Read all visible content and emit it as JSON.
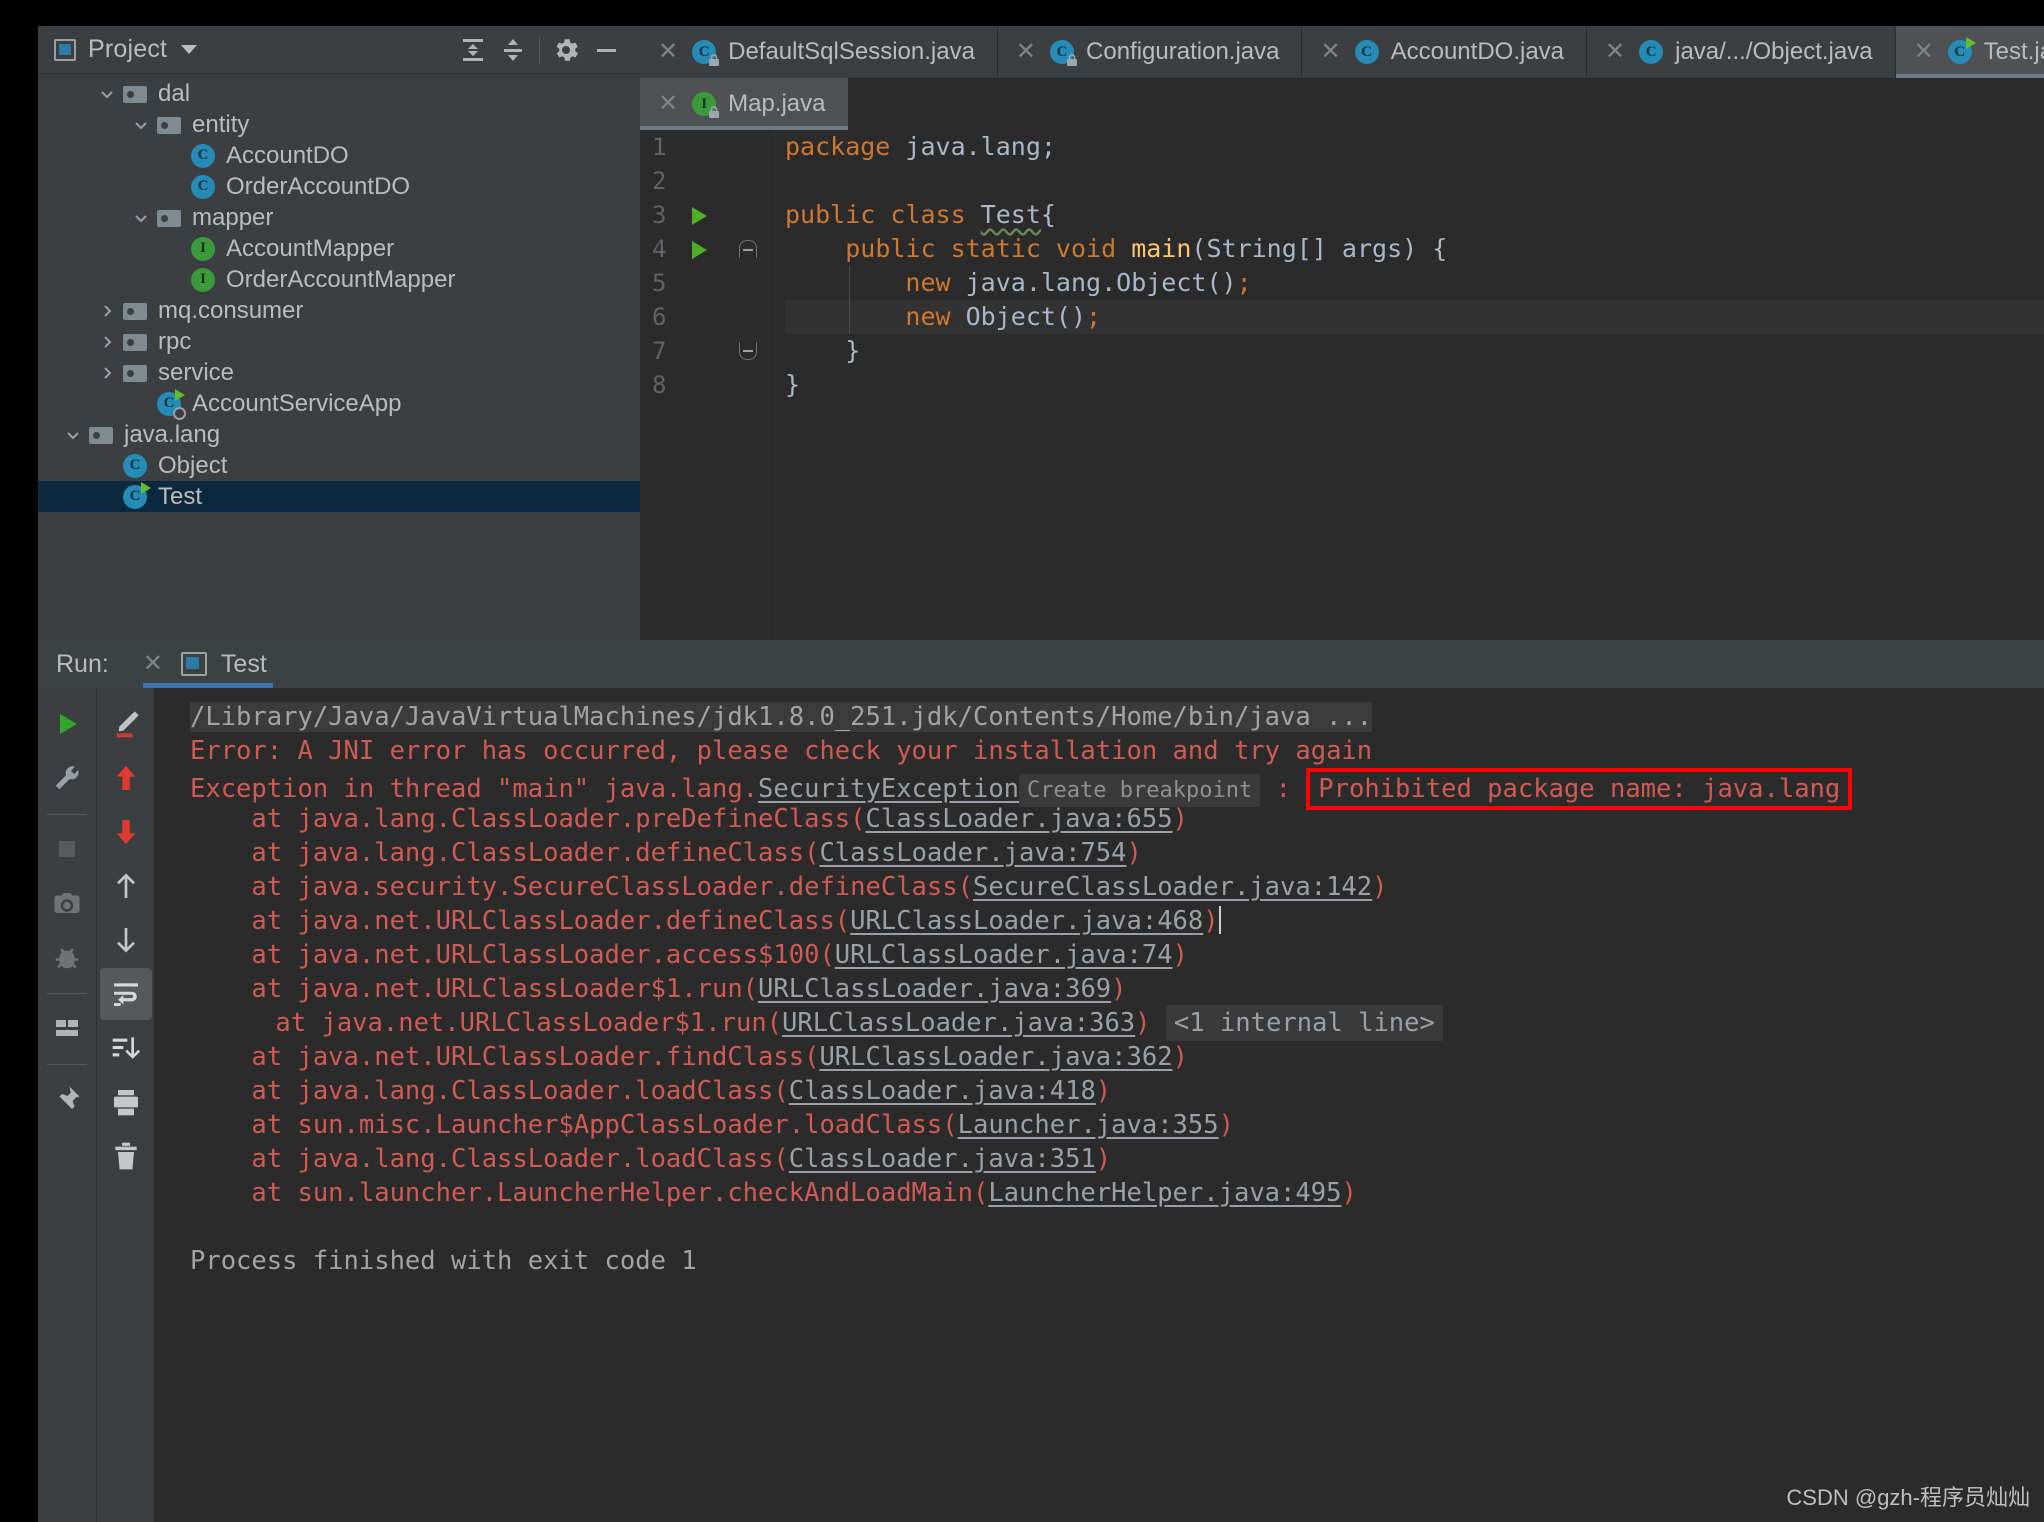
{
  "colors": {
    "panel_bg": "#3c3f41",
    "editor_bg": "#2b2b2b",
    "selection": "#0d293e",
    "error_red": "#cf5b56",
    "box_red": "#ff0000",
    "accent_blue": "#3d72b5",
    "keyword_orange": "#cc7832",
    "method_yellow": "#ffc66d",
    "text_gray": "#a9b7c6"
  },
  "project_panel": {
    "title": "Project",
    "icons": {
      "project": "project-icon",
      "caret": "chevron-down-icon",
      "expand_all": "expand-all-icon",
      "collapse_all": "collapse-all-icon",
      "settings": "gear-icon",
      "hide": "minimize-icon"
    },
    "tree": [
      {
        "label": "dal",
        "indent": 1,
        "twisty": "down",
        "icon": "folder",
        "selected": false
      },
      {
        "label": "entity",
        "indent": 2,
        "twisty": "down",
        "icon": "folder",
        "selected": false
      },
      {
        "label": "AccountDO",
        "indent": 3,
        "twisty": "none",
        "icon": "class",
        "selected": false
      },
      {
        "label": "OrderAccountDO",
        "indent": 3,
        "twisty": "none",
        "icon": "class",
        "selected": false
      },
      {
        "label": "mapper",
        "indent": 2,
        "twisty": "down",
        "icon": "folder",
        "selected": false
      },
      {
        "label": "AccountMapper",
        "indent": 3,
        "twisty": "none",
        "icon": "interface",
        "selected": false
      },
      {
        "label": "OrderAccountMapper",
        "indent": 3,
        "twisty": "none",
        "icon": "interface",
        "selected": false
      },
      {
        "label": "mq.consumer",
        "indent": 1,
        "twisty": "right",
        "icon": "folder",
        "selected": false
      },
      {
        "label": "rpc",
        "indent": 1,
        "twisty": "right",
        "icon": "folder",
        "selected": false
      },
      {
        "label": "service",
        "indent": 1,
        "twisty": "right",
        "icon": "folder",
        "selected": false
      },
      {
        "label": "AccountServiceApp",
        "indent": 2,
        "twisty": "none",
        "icon": "class-run-app",
        "selected": false
      },
      {
        "label": "java.lang",
        "indent": 0,
        "twisty": "down",
        "icon": "folder",
        "selected": false
      },
      {
        "label": "Object",
        "indent": 1,
        "twisty": "none",
        "icon": "class",
        "selected": false
      },
      {
        "label": "Test",
        "indent": 1,
        "twisty": "none",
        "icon": "class-run",
        "selected": true
      }
    ]
  },
  "editor_tabs_row1": [
    {
      "label": "DefaultSqlSession.java",
      "icon": "class-locked",
      "active": false
    },
    {
      "label": "Configuration.java",
      "icon": "class-locked",
      "active": false
    },
    {
      "label": "AccountDO.java",
      "icon": "class",
      "active": false
    },
    {
      "label": "java/.../Object.java",
      "icon": "class",
      "active": false
    },
    {
      "label": "Test.java",
      "icon": "class-run",
      "active": true
    }
  ],
  "editor_tabs_row2": [
    {
      "label": "Map.java",
      "icon": "interface-locked",
      "active": true
    }
  ],
  "code": {
    "lines": [
      {
        "num": "1",
        "gutter_run": false,
        "fold": "none",
        "current": false,
        "tokens": [
          {
            "t": "package",
            "c": "kw"
          },
          {
            "t": " java.lang;",
            "c": "ident"
          }
        ]
      },
      {
        "num": "2",
        "gutter_run": false,
        "fold": "none",
        "current": false,
        "tokens": []
      },
      {
        "num": "3",
        "gutter_run": true,
        "fold": "none",
        "current": false,
        "tokens": [
          {
            "t": "public class ",
            "c": "kw"
          },
          {
            "t": "Test",
            "c": "warn"
          },
          {
            "t": "{",
            "c": "ident"
          }
        ]
      },
      {
        "num": "4",
        "gutter_run": true,
        "fold": "start",
        "current": false,
        "tokens": [
          {
            "t": "    ",
            "c": "ident"
          },
          {
            "t": "public static void ",
            "c": "kw"
          },
          {
            "t": "main",
            "c": "mn"
          },
          {
            "t": "(String[] args) {",
            "c": "ident"
          }
        ]
      },
      {
        "num": "5",
        "gutter_run": false,
        "fold": "none",
        "current": false,
        "tokens": [
          {
            "t": "        ",
            "c": "ident"
          },
          {
            "t": "new",
            "c": "kw"
          },
          {
            "t": " java.lang.Object()",
            "c": "ident"
          },
          {
            "t": ";",
            "c": "kw"
          }
        ]
      },
      {
        "num": "6",
        "gutter_run": false,
        "fold": "none",
        "current": true,
        "tokens": [
          {
            "t": "        ",
            "c": "ident"
          },
          {
            "t": "new",
            "c": "kw"
          },
          {
            "t": " Object()",
            "c": "ident"
          },
          {
            "t": ";",
            "c": "kw"
          }
        ]
      },
      {
        "num": "7",
        "gutter_run": false,
        "fold": "end",
        "current": false,
        "tokens": [
          {
            "t": "    }",
            "c": "ident"
          }
        ]
      },
      {
        "num": "8",
        "gutter_run": false,
        "fold": "none",
        "current": false,
        "tokens": [
          {
            "t": "}",
            "c": "ident"
          }
        ]
      }
    ]
  },
  "run_panel": {
    "label": "Run:",
    "tab_name": "Test",
    "toolbar_left": [
      "run-icon",
      "wrench-icon",
      "separator",
      "stop-icon",
      "camera-icon",
      "debug-off-icon",
      "separator",
      "layout-icon",
      "separator",
      "pin-icon"
    ],
    "toolbar_right": [
      "highlight-pen-icon",
      "up-red-arrow-icon",
      "down-red-arrow-icon",
      "up-arrow-icon",
      "down-arrow-icon",
      "soft-wrap-icon",
      "scroll-to-end-icon",
      "print-icon",
      "trash-icon"
    ],
    "console": [
      {
        "kind": "path",
        "text": "/Library/Java/JavaVirtualMachines/jdk1.8.0_251.jdk/Contents/Home/bin/java ..."
      },
      {
        "kind": "error",
        "text": "Error: A JNI error has occurred, please check your installation and try again"
      },
      {
        "kind": "exception_line",
        "prefix": "Exception in thread \"main\" java.lang.",
        "link": "SecurityException",
        "breakpoint_hint": "Create breakpoint",
        "colon": " : ",
        "boxed": "Prohibited package name: java.lang"
      },
      {
        "kind": "trace",
        "text": "    at java.lang.ClassLoader.preDefineClass(",
        "link": "ClassLoader.java:655",
        "suffix": ")"
      },
      {
        "kind": "trace",
        "text": "    at java.lang.ClassLoader.defineClass(",
        "link": "ClassLoader.java:754",
        "suffix": ")"
      },
      {
        "kind": "trace",
        "text": "    at java.security.SecureClassLoader.defineClass(",
        "link": "SecureClassLoader.java:142",
        "suffix": ")"
      },
      {
        "kind": "trace_caret",
        "text": "    at java.net.URLClassLoader.defineClass(",
        "link": "URLClassLoader.java:468",
        "suffix": ")"
      },
      {
        "kind": "trace",
        "text": "    at java.net.URLClassLoader.access$100(",
        "link": "URLClassLoader.java:74",
        "suffix": ")"
      },
      {
        "kind": "trace",
        "text": "    at java.net.URLClassLoader$1.run(",
        "link": "URLClassLoader.java:369",
        "suffix": ")"
      },
      {
        "kind": "trace_internal",
        "text": "    at java.net.URLClassLoader$1.run(",
        "link": "URLClassLoader.java:363",
        "suffix": ")",
        "internal": "<1 internal line>"
      },
      {
        "kind": "trace",
        "text": "    at java.net.URLClassLoader.findClass(",
        "link": "URLClassLoader.java:362",
        "suffix": ")"
      },
      {
        "kind": "trace",
        "text": "    at java.lang.ClassLoader.loadClass(",
        "link": "ClassLoader.java:418",
        "suffix": ")"
      },
      {
        "kind": "trace",
        "text": "    at sun.misc.Launcher$AppClassLoader.loadClass(",
        "link": "Launcher.java:355",
        "suffix": ")"
      },
      {
        "kind": "trace",
        "text": "    at java.lang.ClassLoader.loadClass(",
        "link": "ClassLoader.java:351",
        "suffix": ")"
      },
      {
        "kind": "trace",
        "text": "    at sun.launcher.LauncherHelper.checkAndLoadMain(",
        "link": "LauncherHelper.java:495",
        "suffix": ")"
      },
      {
        "kind": "blank",
        "text": ""
      },
      {
        "kind": "exit",
        "text": "Process finished with exit code 1"
      }
    ]
  },
  "watermark": "CSDN @gzh-程序员灿灿"
}
